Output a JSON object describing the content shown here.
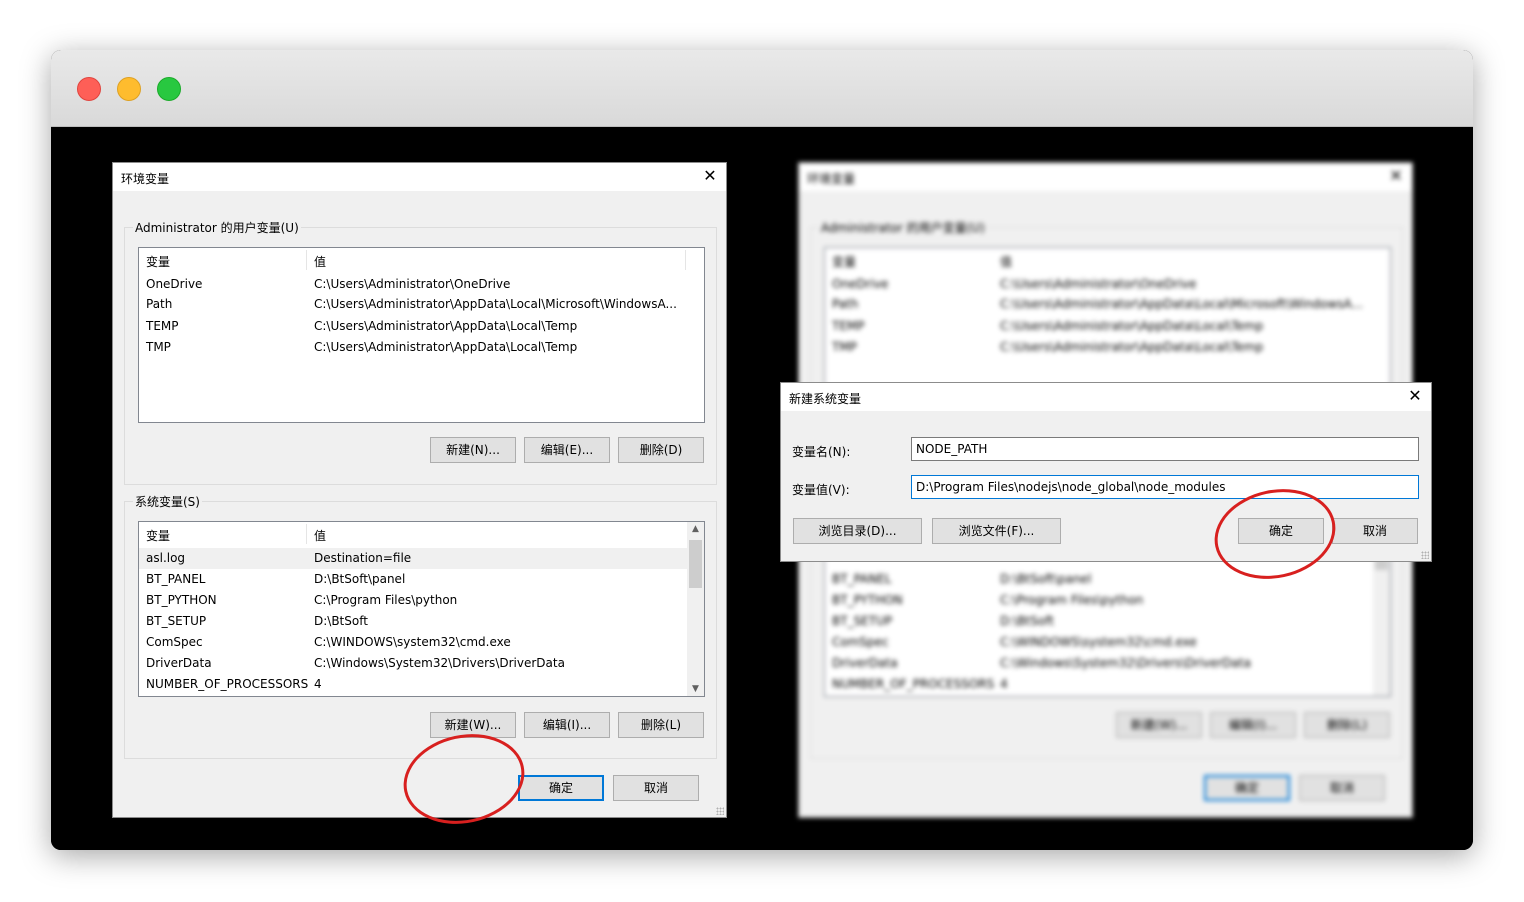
{
  "dialog_env": {
    "title": "环境变量",
    "close": "✕",
    "user_group_label": "Administrator 的用户变量(U)",
    "col_var": "变量",
    "col_val": "值",
    "user_rows": [
      {
        "var": "OneDrive",
        "val": "C:\\Users\\Administrator\\OneDrive"
      },
      {
        "var": "Path",
        "val": "C:\\Users\\Administrator\\AppData\\Local\\Microsoft\\WindowsA..."
      },
      {
        "var": "TEMP",
        "val": "C:\\Users\\Administrator\\AppData\\Local\\Temp"
      },
      {
        "var": "TMP",
        "val": "C:\\Users\\Administrator\\AppData\\Local\\Temp"
      }
    ],
    "user_btn_new": "新建(N)...",
    "user_btn_edit": "编辑(E)...",
    "user_btn_delete": "删除(D)",
    "sys_group_label": "系统变量(S)",
    "sys_rows": [
      {
        "var": "asl.log",
        "val": "Destination=file"
      },
      {
        "var": "BT_PANEL",
        "val": "D:\\BtSoft\\panel"
      },
      {
        "var": "BT_PYTHON",
        "val": "C:\\Program Files\\python"
      },
      {
        "var": "BT_SETUP",
        "val": "D:\\BtSoft"
      },
      {
        "var": "ComSpec",
        "val": "C:\\WINDOWS\\system32\\cmd.exe"
      },
      {
        "var": "DriverData",
        "val": "C:\\Windows\\System32\\Drivers\\DriverData"
      },
      {
        "var": "NUMBER_OF_PROCESSORS",
        "val": "4"
      }
    ],
    "sys_btn_new": "新建(W)...",
    "sys_btn_edit": "编辑(I)...",
    "sys_btn_delete": "删除(L)",
    "ok": "确定",
    "cancel": "取消"
  },
  "dialog_new": {
    "title": "新建系统变量",
    "close": "✕",
    "name_label": "变量名(N):",
    "name_value": "NODE_PATH",
    "value_label": "变量值(V):",
    "value_value": "D:\\Program Files\\nodejs\\node_global\\node_modules",
    "browse_dir": "浏览目录(D)...",
    "browse_file": "浏览文件(F)...",
    "ok": "确定",
    "cancel": "取消"
  },
  "colors": {
    "highlight_circle": "#d8201f",
    "default_button_border": "#0078d7",
    "mac_close": "#fe5f57",
    "mac_minimize": "#febc2e",
    "mac_zoom": "#28c840"
  }
}
